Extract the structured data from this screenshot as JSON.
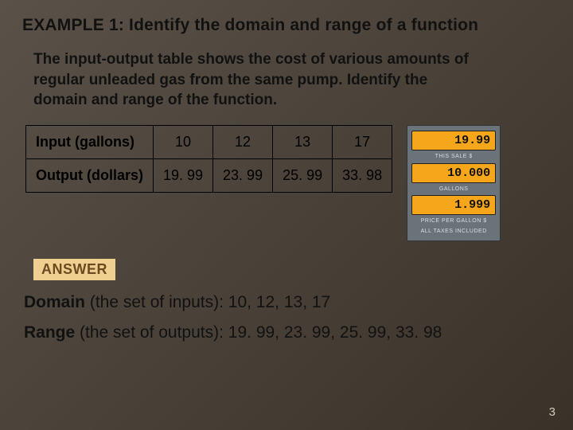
{
  "title": "EXAMPLE 1: Identify the domain and range of a function",
  "prompt": "The input-output table shows the cost of various amounts of regular unleaded gas from the same pump. Identify the domain and range of the function.",
  "table": {
    "row1_label": "Input (gallons)",
    "row1": [
      "10",
      "12",
      "13",
      "17"
    ],
    "row2_label": "Output (dollars)",
    "row2": [
      "19. 99",
      "23. 99",
      "25. 99",
      "33. 98"
    ]
  },
  "pump": {
    "sale_value": "19.99",
    "sale_label": "THIS SALE $",
    "gallons_value": "10.000",
    "gallons_label": "GALLONS",
    "price_value": "1.999",
    "price_label": "PRICE PER GALLON $",
    "tax_label": "ALL TAXES INCLUDED"
  },
  "answer": {
    "badge": "ANSWER",
    "domain_term": "Domain",
    "domain_note": " (the set of inputs): ",
    "domain_values": "10, 12, 13, 17",
    "range_term": "Range",
    "range_note": " (the set of outputs): ",
    "range_values": "19. 99, 23. 99, 25. 99, 33. 98"
  },
  "page_number": "3",
  "chart_data": {
    "type": "table",
    "title": "Cost of regular unleaded gas",
    "columns": [
      "Input (gallons)",
      "Output (dollars)"
    ],
    "rows": [
      {
        "gallons": 10,
        "dollars": 19.99
      },
      {
        "gallons": 12,
        "dollars": 23.99
      },
      {
        "gallons": 13,
        "dollars": 25.99
      },
      {
        "gallons": 17,
        "dollars": 33.98
      }
    ],
    "domain": [
      10,
      12,
      13,
      17
    ],
    "range": [
      19.99,
      23.99,
      25.99,
      33.98
    ],
    "price_per_gallon": 1.999
  }
}
